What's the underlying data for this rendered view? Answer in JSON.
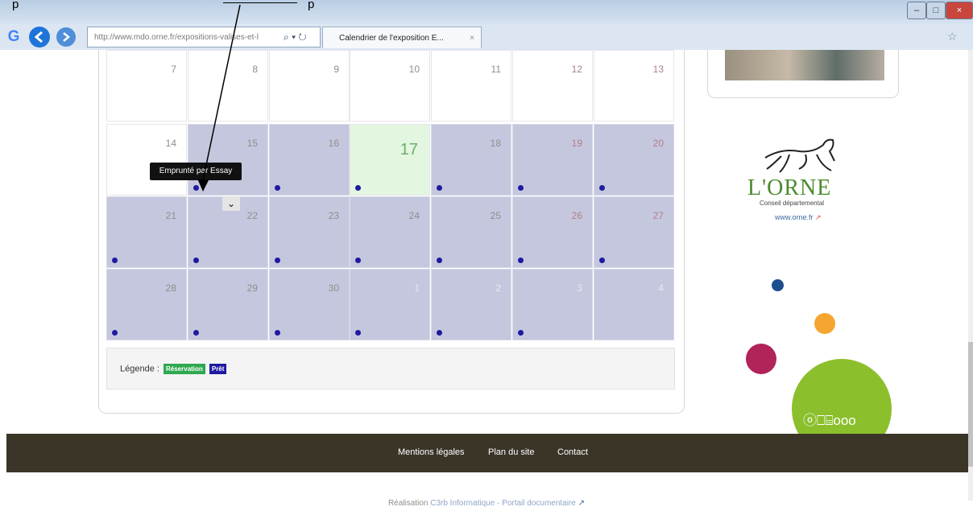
{
  "browser": {
    "url": "http://www.mdo.orne.fr/expositions-valises-et-l",
    "tab_title": "Calendrier de l'exposition E...",
    "tab_close": "×",
    "search_icon": "search-icon",
    "refresh_icon": "refresh-icon",
    "window_controls": [
      "minimize",
      "maximize",
      "close"
    ]
  },
  "annotation": {
    "left_text": "p",
    "underlined_text": "",
    "right_text": "p"
  },
  "calendar": {
    "rows": [
      [
        {
          "day": "7",
          "weekend": false,
          "busy": false,
          "other": false,
          "dot": false
        },
        {
          "day": "8",
          "weekend": false,
          "busy": false,
          "other": false,
          "dot": false
        },
        {
          "day": "9",
          "weekend": false,
          "busy": false,
          "other": false,
          "dot": false
        },
        {
          "day": "10",
          "weekend": false,
          "busy": false,
          "other": false,
          "dot": false
        },
        {
          "day": "11",
          "weekend": false,
          "busy": false,
          "other": false,
          "dot": false
        },
        {
          "day": "12",
          "weekend": true,
          "busy": false,
          "other": false,
          "dot": false
        },
        {
          "day": "13",
          "weekend": true,
          "busy": false,
          "other": false,
          "dot": false
        }
      ],
      [
        {
          "day": "14",
          "weekend": false,
          "busy": false,
          "other": false,
          "dot": false
        },
        {
          "day": "15",
          "weekend": false,
          "busy": true,
          "other": false,
          "dot": true
        },
        {
          "day": "16",
          "weekend": false,
          "busy": true,
          "other": false,
          "dot": true
        },
        {
          "day": "17",
          "weekend": false,
          "busy": false,
          "other": false,
          "dot": true,
          "today": true
        },
        {
          "day": "18",
          "weekend": false,
          "busy": true,
          "other": false,
          "dot": true
        },
        {
          "day": "19",
          "weekend": true,
          "busy": true,
          "other": false,
          "dot": true
        },
        {
          "day": "20",
          "weekend": true,
          "busy": true,
          "other": false,
          "dot": true
        }
      ],
      [
        {
          "day": "21",
          "weekend": false,
          "busy": true,
          "other": false,
          "dot": true
        },
        {
          "day": "22",
          "weekend": false,
          "busy": true,
          "other": false,
          "dot": true
        },
        {
          "day": "23",
          "weekend": false,
          "busy": true,
          "other": false,
          "dot": true
        },
        {
          "day": "24",
          "weekend": false,
          "busy": true,
          "other": false,
          "dot": true
        },
        {
          "day": "25",
          "weekend": false,
          "busy": true,
          "other": false,
          "dot": true
        },
        {
          "day": "26",
          "weekend": true,
          "busy": true,
          "other": false,
          "dot": true
        },
        {
          "day": "27",
          "weekend": true,
          "busy": true,
          "other": false,
          "dot": true
        }
      ],
      [
        {
          "day": "28",
          "weekend": false,
          "busy": true,
          "other": false,
          "dot": true
        },
        {
          "day": "29",
          "weekend": false,
          "busy": true,
          "other": false,
          "dot": true
        },
        {
          "day": "30",
          "weekend": false,
          "busy": true,
          "other": false,
          "dot": true
        },
        {
          "day": "1",
          "weekend": false,
          "busy": true,
          "other": true,
          "dot": true
        },
        {
          "day": "2",
          "weekend": false,
          "busy": true,
          "other": true,
          "dot": true
        },
        {
          "day": "3",
          "weekend": true,
          "busy": true,
          "other": true,
          "dot": true
        },
        {
          "day": "4",
          "weekend": true,
          "busy": true,
          "other": true,
          "dot": false
        }
      ]
    ],
    "tooltip": "Emprunté par Essay",
    "expand_icon": "chevron-down-icon"
  },
  "legend": {
    "label": "Légende :",
    "reservation": "Réservation",
    "pret": "Prêt"
  },
  "colors": {
    "busy": "#c5c7de",
    "today": "#e2f6e0",
    "dot": "#1f1aa0",
    "reservation": "#2fa84f",
    "pret": "#1f1aa0",
    "footer": "#3b3528"
  },
  "sidebar": {
    "brand": "L'ORNE",
    "subtitle": "Conseil départemental",
    "link": "www.orne.fr",
    "link_icon": "external-link-icon",
    "bubble_label": "ⓞ⎕⌸ooo"
  },
  "footer": {
    "links": [
      "Mentions légales",
      "Plan du site",
      "Contact"
    ],
    "credit_prefix": "Réalisation ",
    "credit_link": "C3rb Informatique - Portail documentaire",
    "credit_icon": "external-link-icon"
  }
}
